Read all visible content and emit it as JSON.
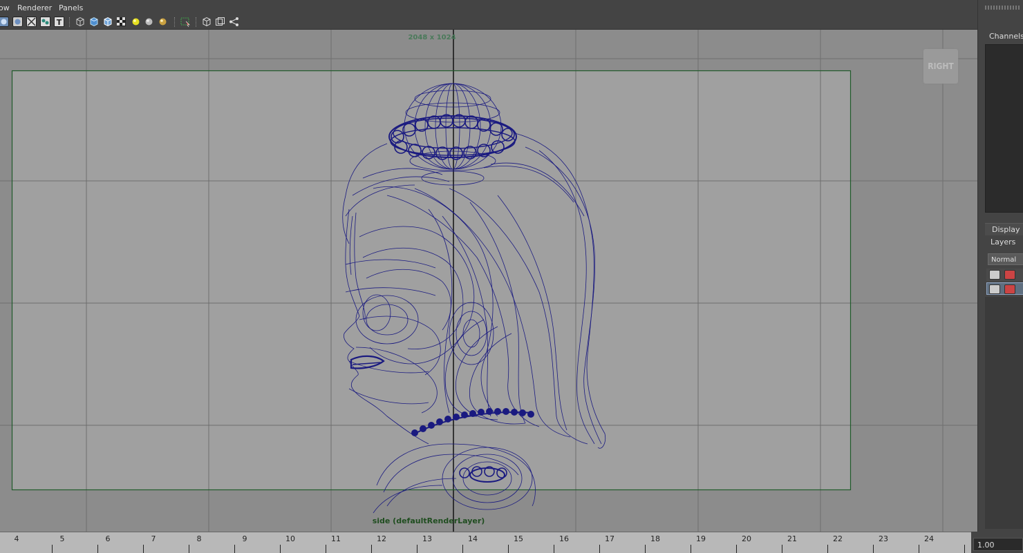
{
  "menu": {
    "items": [
      "ow",
      "Renderer",
      "Panels"
    ]
  },
  "toolbar": {
    "icons": [
      "camera-attributes-icon",
      "camera-lock-icon",
      "xray-icon",
      "snapshot-icon",
      "text-icon",
      "wireframe-cube-icon",
      "smooth-shade-icon",
      "shaded-wire-icon",
      "textured-icon",
      "use-all-lights-icon",
      "shadows-icon",
      "high-quality-icon",
      "isolate-select-icon",
      "grid-icon",
      "film-gate-icon",
      "resolution-gate-icon"
    ]
  },
  "viewport": {
    "resolution_label": "2048 x 1024",
    "camera_label": "side (defaultRenderLayer)",
    "view_cube_label": "RIGHT",
    "wire_color": "#1a1a80",
    "gate_color": "#1f5a2a"
  },
  "right_panel": {
    "channels_label": "Channels",
    "display_tab": "Display",
    "layers_tab": "Layers",
    "layer_mode": "Normal",
    "layers": [
      {
        "selected": false
      },
      {
        "selected": true
      }
    ]
  },
  "timeline": {
    "frames": [
      "4",
      "5",
      "6",
      "7",
      "8",
      "9",
      "10",
      "11",
      "12",
      "13",
      "14",
      "15",
      "16",
      "17",
      "18",
      "19",
      "20",
      "21",
      "22",
      "23",
      "24"
    ],
    "current_value": "1.00"
  }
}
